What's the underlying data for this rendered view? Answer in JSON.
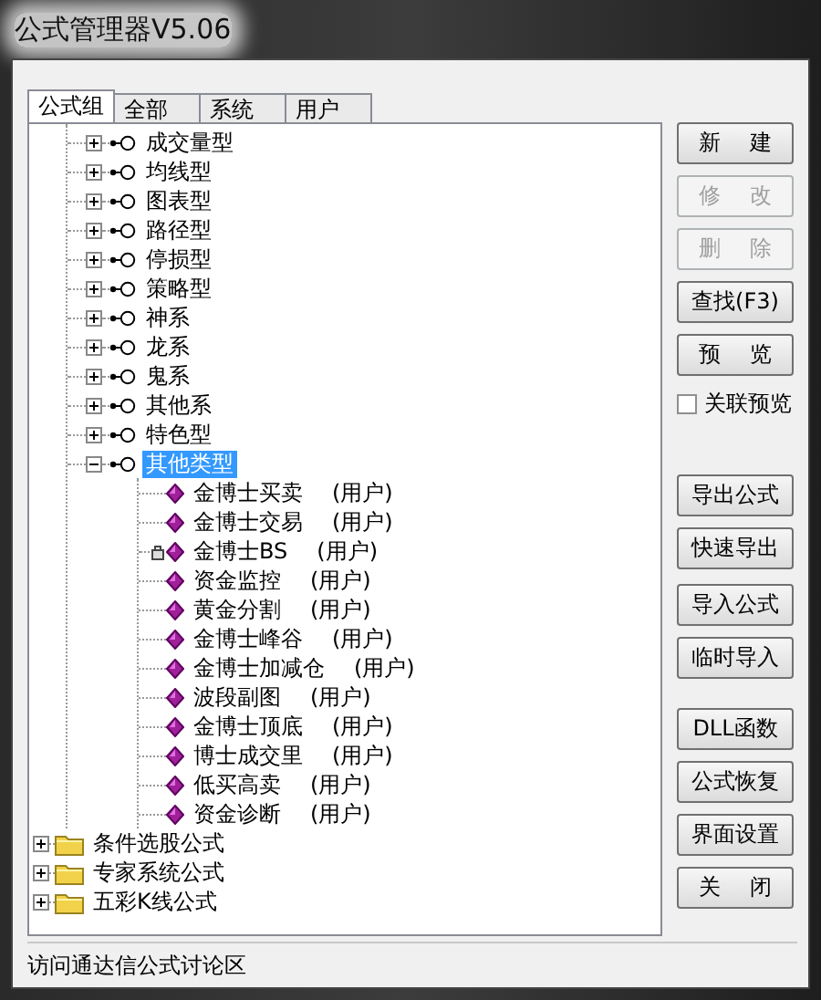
{
  "window": {
    "title": "公式管理器V5.06"
  },
  "tabs": [
    {
      "label": "公式组",
      "selected": true
    },
    {
      "label": "全部",
      "selected": false
    },
    {
      "label": "系统",
      "selected": false
    },
    {
      "label": "用户",
      "selected": false
    }
  ],
  "tree": {
    "groups": [
      {
        "label": "成交量型",
        "expanded": false,
        "selected": false
      },
      {
        "label": "均线型",
        "expanded": false,
        "selected": false
      },
      {
        "label": "图表型",
        "expanded": false,
        "selected": false
      },
      {
        "label": "路径型",
        "expanded": false,
        "selected": false
      },
      {
        "label": "停损型",
        "expanded": false,
        "selected": false
      },
      {
        "label": "策略型",
        "expanded": false,
        "selected": false
      },
      {
        "label": "神系",
        "expanded": false,
        "selected": false
      },
      {
        "label": "龙系",
        "expanded": false,
        "selected": false
      },
      {
        "label": "鬼系",
        "expanded": false,
        "selected": false
      },
      {
        "label": "其他系",
        "expanded": false,
        "selected": false
      },
      {
        "label": "特色型",
        "expanded": false,
        "selected": false
      },
      {
        "label": "其他类型",
        "expanded": true,
        "selected": true,
        "children": [
          {
            "label": "金博士买卖",
            "tag": "(用户)",
            "locked": false
          },
          {
            "label": "金博士交易",
            "tag": "(用户)",
            "locked": false
          },
          {
            "label": "金博士BS",
            "tag": "(用户)",
            "locked": true
          },
          {
            "label": "资金监控",
            "tag": "(用户)",
            "locked": false
          },
          {
            "label": "黄金分割",
            "tag": "(用户)",
            "locked": false
          },
          {
            "label": "金博士峰谷",
            "tag": "(用户)",
            "locked": false
          },
          {
            "label": "金博士加减仓",
            "tag": "(用户)",
            "locked": false
          },
          {
            "label": "波段副图",
            "tag": "(用户)",
            "locked": false
          },
          {
            "label": "金博士顶底",
            "tag": "(用户)",
            "locked": false
          },
          {
            "label": "博士成交里",
            "tag": "(用户)",
            "locked": false
          },
          {
            "label": "低买高卖",
            "tag": "(用户)",
            "locked": false
          },
          {
            "label": "资金诊断",
            "tag": "(用户)",
            "locked": false
          }
        ]
      }
    ],
    "folders": [
      {
        "label": "条件选股公式",
        "expanded": false
      },
      {
        "label": "专家系统公式",
        "expanded": false
      },
      {
        "label": "五彩K线公式",
        "expanded": false
      }
    ]
  },
  "side_panel": {
    "sections": [
      {
        "buttons": [
          {
            "label": "新 建",
            "disabled": false
          },
          {
            "label": "修 改",
            "disabled": true
          },
          {
            "label": "删 除",
            "disabled": true
          },
          {
            "label": "查找(F3)",
            "disabled": false
          },
          {
            "label": "预 览",
            "disabled": false
          }
        ],
        "checkbox": {
          "label": "关联预览",
          "checked": false
        }
      },
      {
        "buttons": [
          {
            "label": "导出公式",
            "disabled": false
          },
          {
            "label": "快速导出",
            "disabled": false
          }
        ]
      },
      {
        "buttons": [
          {
            "label": "导入公式",
            "disabled": false
          },
          {
            "label": "临时导入",
            "disabled": false
          }
        ]
      },
      {
        "buttons": [
          {
            "label": "DLL函数",
            "disabled": false
          },
          {
            "label": "公式恢复",
            "disabled": false
          },
          {
            "label": "界面设置",
            "disabled": false
          },
          {
            "label": "关 闭",
            "disabled": false
          }
        ]
      }
    ]
  },
  "status_bar": {
    "text": "访问通达信公式讨论区"
  }
}
